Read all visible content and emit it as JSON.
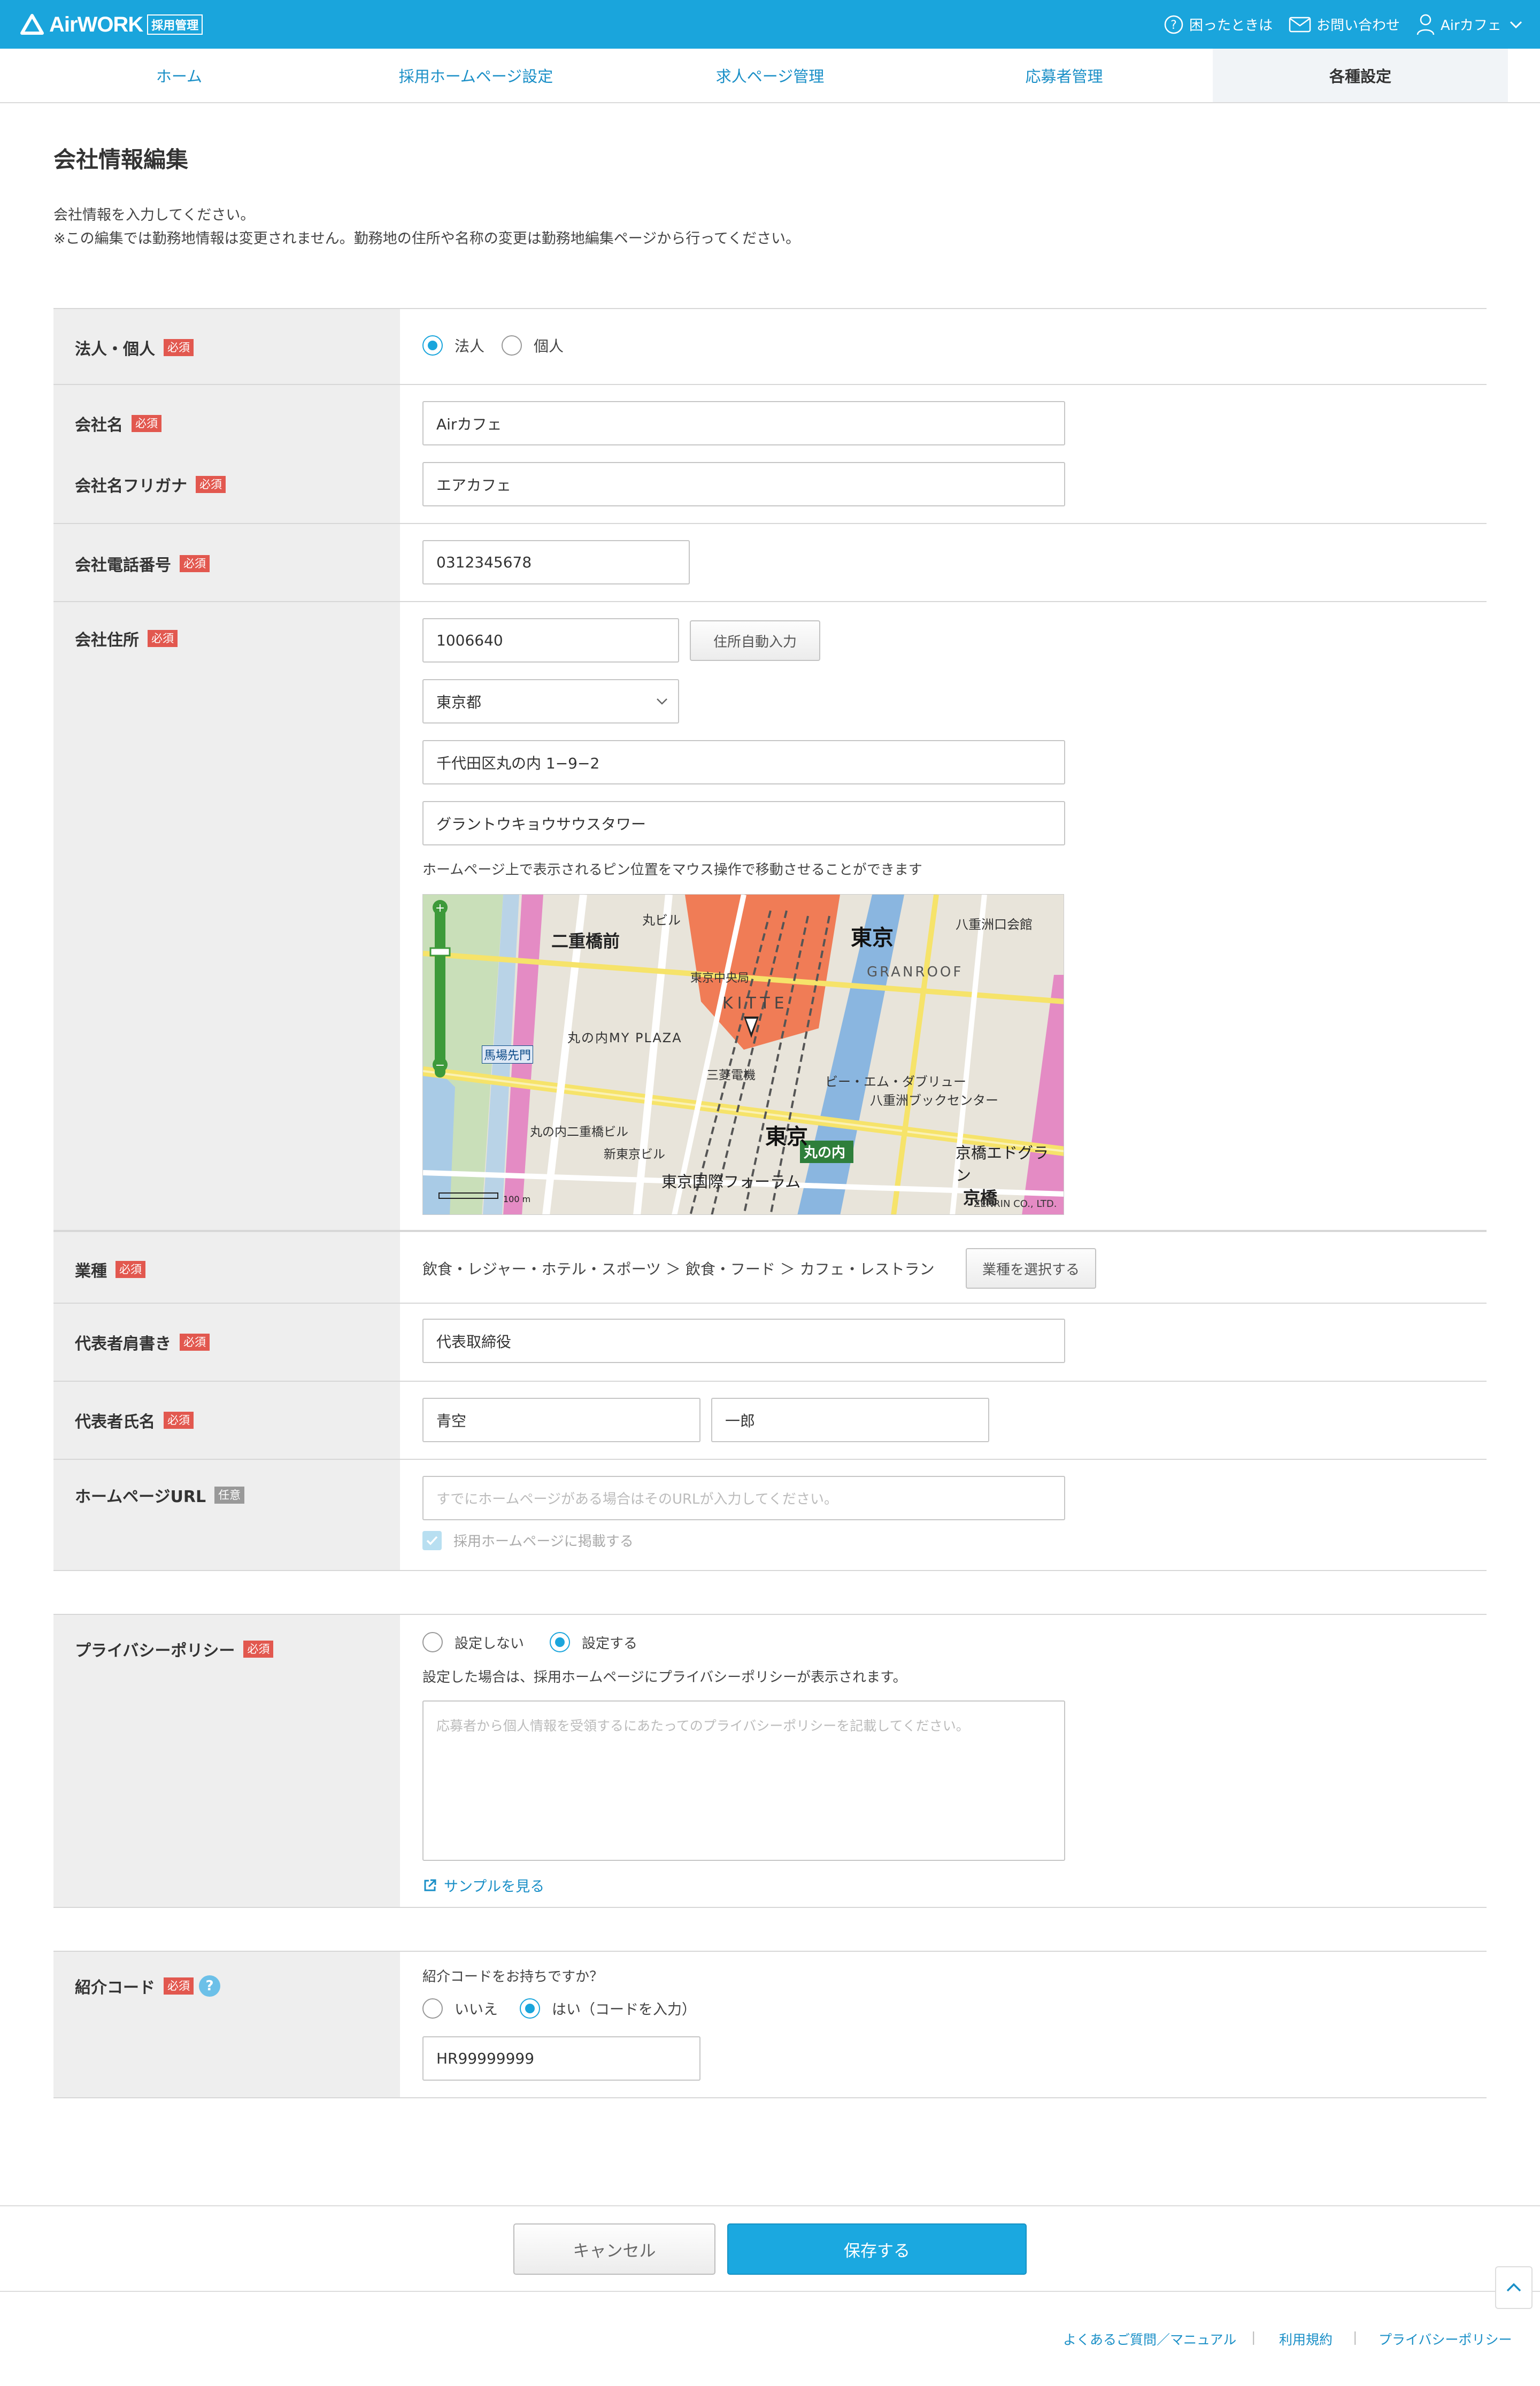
{
  "header": {
    "logo_text": "AirWORK",
    "logo_badge": "採用管理",
    "help": "困ったときは",
    "contact": "お問い合わせ",
    "account": "Airカフェ"
  },
  "nav": {
    "tabs": [
      {
        "label": "ホーム"
      },
      {
        "label": "採用ホームページ設定"
      },
      {
        "label": "求人ページ管理"
      },
      {
        "label": "応募者管理"
      },
      {
        "label": "各種設定"
      }
    ],
    "active": "各種設定"
  },
  "page": {
    "title": "会社情報編集",
    "intro_1": "会社情報を入力してください。",
    "intro_2": "※この編集では勤務地情報は変更されません。勤務地の住所や名称の変更は勤務地編集ページから行ってください。"
  },
  "badges": {
    "required": "必須",
    "optional": "任意"
  },
  "form": {
    "entity": {
      "label": "法人・個人",
      "options": [
        "法人",
        "個人"
      ],
      "selected": "法人"
    },
    "company_name": {
      "label": "会社名",
      "value": "Airカフェ"
    },
    "company_kana": {
      "label": "会社名フリガナ",
      "value": "エアカフェ"
    },
    "phone": {
      "label": "会社電話番号",
      "value": "0312345678"
    },
    "address": {
      "label": "会社住所",
      "zip": "1006640",
      "auto_button": "住所自動入力",
      "prefecture": "東京都",
      "street": "千代田区丸の内 1−9−2",
      "building": "グラントウキョウサウスタワー",
      "map_hint": "ホームページ上で表示されるピン位置をマウス操作で移動させることができます"
    },
    "map": {
      "labels": [
        "二重橋前",
        "東京",
        "馬場先門",
        "丸の内二重橋ビル",
        "新東京ビル",
        "東京国際フォーラム",
        "三菱電機",
        "丸の内",
        "八重洲ブックセンター",
        "ビー・エム・ダブリュー",
        "京橋エドグラン",
        "京橋",
        "八重洲口会館",
        "GRANROOF",
        "KITTE",
        "丸の内MY PLAZA",
        "丸ビル",
        "東京中央局",
        "100 m",
        "ZENRIN CO., LTD."
      ]
    },
    "industry": {
      "label": "業種",
      "value": "飲食・レジャー・ホテル・スポーツ ＞ 飲食・フード ＞ カフェ・レストラン",
      "button": "業種を選択する"
    },
    "rep_title": {
      "label": "代表者肩書き",
      "value": "代表取締役"
    },
    "rep_name": {
      "label": "代表者氏名",
      "last": "青空",
      "first": "一郎"
    },
    "homepage": {
      "label": "ホームページURL",
      "placeholder": "すでにホームページがある場合はそのURLが入力してください。",
      "checkbox": "採用ホームページに掲載する"
    },
    "privacy": {
      "label": "プライバシーポリシー",
      "options": [
        "設定しない",
        "設定する"
      ],
      "selected": "設定する",
      "note": "設定した場合は、採用ホームページにプライバシーポリシーが表示されます。",
      "placeholder": "応募者から個人情報を受領するにあたってのプライバシーポリシーを記載してください。",
      "sample_link": "サンプルを見る"
    },
    "referral": {
      "label": "紹介コード",
      "question": "紹介コードをお持ちですか？",
      "options": [
        "いいえ",
        "はい（コードを入力）"
      ],
      "selected": "はい（コードを入力）",
      "value": "HR99999999"
    }
  },
  "actions": {
    "cancel": "キャンセル",
    "save": "保存する"
  },
  "footer": {
    "links": [
      "よくあるご質問／マニュアル",
      "利用規約",
      "プライバシーポリシー"
    ],
    "separator": "|"
  },
  "colors": {
    "brand": "#1aa5dc",
    "required_badge": "#e2584f",
    "link": "#1a8fc7"
  }
}
